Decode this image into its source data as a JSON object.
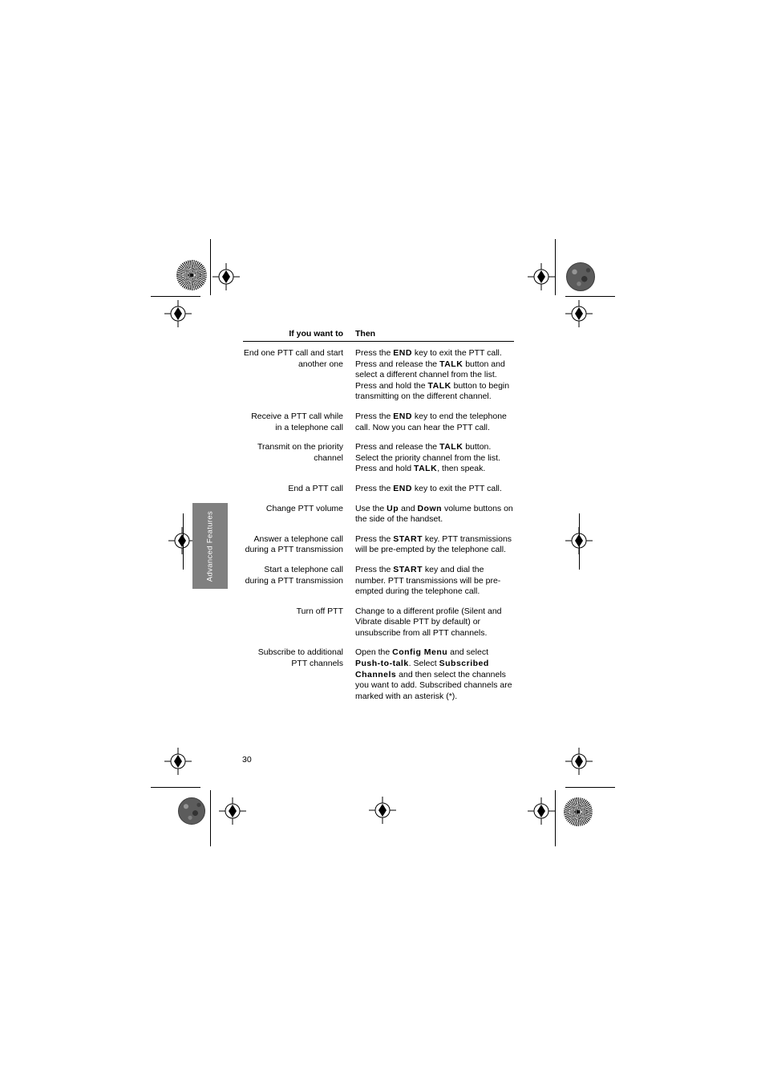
{
  "page": {
    "number": "30",
    "side_tab_label": "Advanced Features"
  },
  "table": {
    "headers": {
      "col_a": "If you want to",
      "col_b": "Then"
    },
    "rows": [
      {
        "condition": "End one PTT call and start another one",
        "action_html": "Press the <b>END</b> key to exit the PTT call. Press and release the <b>TALK</b> button and select a different channel from the list. Press and hold the <b>TALK</b> button to begin transmitting on the different channel.",
        "action_text": "Press the END key to exit the PTT call. Press and release the TALK button and select a different channel from the list. Press and hold the TALK button to begin transmitting on the different channel."
      },
      {
        "condition": "Receive a PTT call while in a telephone call",
        "action_html": "Press the <b>END</b> key to end the telephone call. Now you can hear the PTT call.",
        "action_text": "Press the END key to end the telephone call. Now you can hear the PTT call."
      },
      {
        "condition": "Transmit on the priority channel",
        "action_html": "Press and release the <b>TALK</b> button. Select the priority channel from the list. Press and hold <b>TALK</b>, then speak.",
        "action_text": "Press and release the TALK button. Select the priority channel from the list. Press and hold TALK, then speak."
      },
      {
        "condition": "End a PTT call",
        "action_html": "Press the <b>END</b> key to exit the PTT call.",
        "action_text": "Press the END key to exit the PTT call."
      },
      {
        "condition": "Change PTT volume",
        "action_html": "Use the <b>Up</b> and <b>Down</b> volume buttons on the side of the handset.",
        "action_text": "Use the Up and Down volume buttons on the side of the handset."
      },
      {
        "condition": "Answer a telephone call during a PTT transmission",
        "action_html": "Press the <b>START</b> key. PTT transmissions will be pre-empted by the telephone call.",
        "action_text": "Press the START key. PTT transmissions will be pre-empted by the telephone call."
      },
      {
        "condition": "Start a telephone call during a PTT transmission",
        "action_html": "Press the <b>START</b> key and dial the number. PTT transmissions will be pre-empted during the telephone call.",
        "action_text": "Press the START key and dial the number. PTT transmissions will be pre-empted during the telephone call."
      },
      {
        "condition": "Turn off PTT",
        "action_html": "Change to a different profile (Silent and Vibrate disable PTT by default) or unsubscribe from all PTT channels.",
        "action_text": "Change to a different profile (Silent and Vibrate disable PTT by default) or unsubscribe from all PTT channels."
      },
      {
        "condition": "Subscribe to additional PTT channels",
        "action_html": "Open the <b>Config Menu</b> and select <b>Push-to-talk</b>. Select <b>Subscribed Channels</b> and then select the channels you want to add. Subscribed channels are marked with an asterisk (*).",
        "action_text": "Open the Config Menu and select Push-to-talk. Select Subscribed Channels and then select the channels you want to add. Subscribed channels are marked with an asterisk (*)."
      }
    ]
  },
  "colors": {
    "tab_background": "#808080",
    "tab_text": "#ffffff",
    "body_text": "#000000",
    "page_background": "#ffffff"
  }
}
